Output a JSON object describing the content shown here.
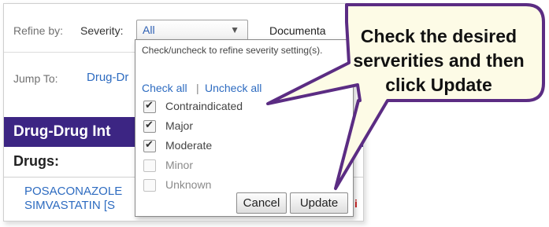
{
  "refine": {
    "label": "Refine by:",
    "severity_label": "Severity:",
    "severity_value": "All",
    "documentation_label": "Documenta"
  },
  "jump": {
    "label": "Jump To:",
    "link": "Drug-Dr"
  },
  "banner": {
    "title": "Drug-Drug  Int"
  },
  "drugs": {
    "label": "Drugs:",
    "items": [
      "POSACONAZOLE",
      "SIMVASTATIN [S"
    ],
    "fragment": "i"
  },
  "severity_panel": {
    "instruction": "Check/uncheck to refine severity setting(s).",
    "check_all": "Check all",
    "separator": "|",
    "uncheck_all": "Uncheck all",
    "options": [
      {
        "label": "Contraindicated",
        "checked": true
      },
      {
        "label": "Major",
        "checked": true
      },
      {
        "label": "Moderate",
        "checked": true
      },
      {
        "label": "Minor",
        "checked": false
      },
      {
        "label": "Unknown",
        "checked": false
      }
    ],
    "cancel_label": "Cancel",
    "update_label": "Update"
  },
  "callout": {
    "lines": [
      "Check the desired",
      "serverities and then",
      "click Update"
    ],
    "fill": "#fdfbe6",
    "border": "#5b2c83"
  },
  "colors": {
    "banner": "#3c2583",
    "link": "#2d6bc0"
  }
}
